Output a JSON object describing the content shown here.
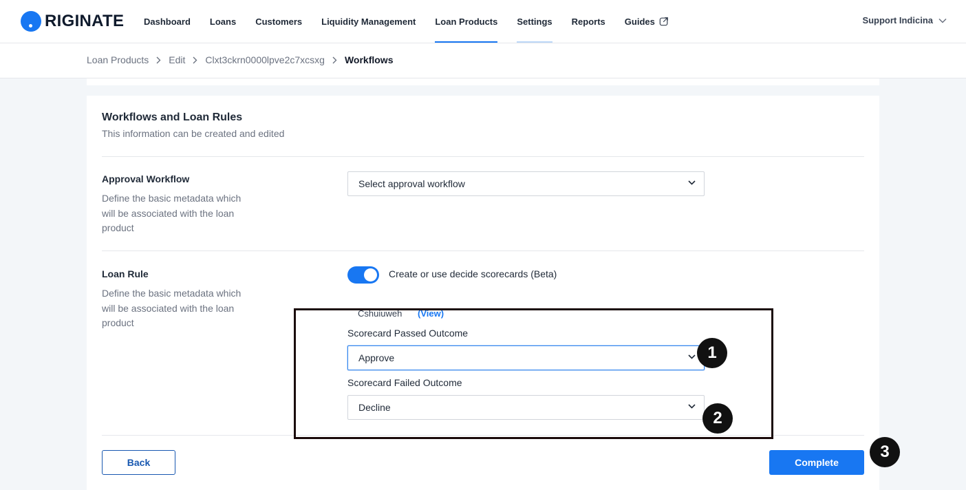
{
  "brand": {
    "logo_text": "RIGINATE",
    "accent": "#1877f2"
  },
  "nav": {
    "items": [
      {
        "label": "Dashboard"
      },
      {
        "label": "Loans"
      },
      {
        "label": "Customers"
      },
      {
        "label": "Liquidity Management"
      },
      {
        "label": "Loan Products"
      },
      {
        "label": "Settings"
      },
      {
        "label": "Reports"
      },
      {
        "label": "Guides"
      }
    ],
    "active": "Loan Products",
    "user": "Support Indicina"
  },
  "breadcrumb": {
    "items": [
      "Loan Products",
      "Edit",
      "Clxt3ckrn0000lpve2c7xcsxg",
      "Workflows"
    ]
  },
  "card": {
    "title": "Workflows and Loan Rules",
    "subtitle": "This information can be created and edited"
  },
  "approval_workflow": {
    "title": "Approval Workflow",
    "description": "Define the basic metadata which will be associated with the loan product",
    "select_value": "Select approval workflow"
  },
  "loan_rule": {
    "title": "Loan Rule",
    "description": "Define the basic metadata which will be associated with the loan product",
    "toggle_label": "Create or use decide scorecards (Beta)",
    "toggle_on": true,
    "scorecard_name": "Cshuiuweh",
    "view_link": "(View)",
    "passed_label": "Scorecard Passed Outcome",
    "passed_value": "Approve",
    "failed_label": "Scorecard Failed Outcome",
    "failed_value": "Decline"
  },
  "actions": {
    "back": "Back",
    "complete": "Complete"
  },
  "annotations": {
    "badge_1": "1",
    "badge_2": "2",
    "badge_3": "3"
  }
}
